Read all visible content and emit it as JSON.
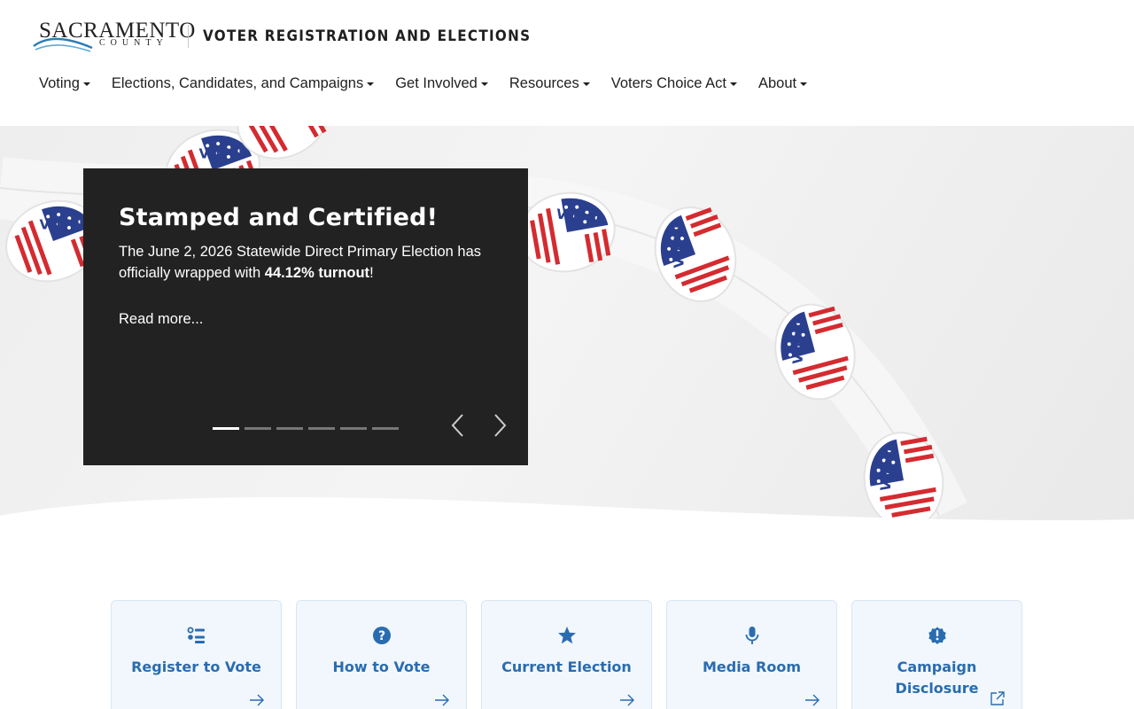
{
  "header": {
    "logo_text": "SACRAMENTO",
    "logo_subtext": "COUNTY",
    "site_title": "VOTER REGISTRATION AND ELECTIONS"
  },
  "nav": {
    "items": [
      {
        "label": "Voting"
      },
      {
        "label": "Elections, Candidates, and Campaigns"
      },
      {
        "label": "Get Involved"
      },
      {
        "label": "Resources"
      },
      {
        "label": "Voters Choice Act"
      },
      {
        "label": "About"
      }
    ]
  },
  "carousel": {
    "title": "Stamped and Certified!",
    "body_prefix": "The June 2, 2026 Statewide Direct Primary Election has officially wrapped with ",
    "body_bold": "44.12% turnout",
    "body_suffix": "!",
    "read_more": "Read more...",
    "slide_count": 6,
    "active_slide": 1
  },
  "quick_links": [
    {
      "label": "Register to Vote",
      "icon": "list-icon"
    },
    {
      "label": "How to Vote",
      "icon": "question-circle-icon"
    },
    {
      "label": "Current Election",
      "icon": "star-icon"
    },
    {
      "label": "Media Room",
      "icon": "microphone-icon"
    },
    {
      "label": "Campaign Disclosure",
      "icon": "exclamation-badge-icon",
      "external": true
    }
  ],
  "colors": {
    "accent": "#2a6cb0",
    "caption_bg": "#222222",
    "card_bg": "#f1f7fd"
  }
}
